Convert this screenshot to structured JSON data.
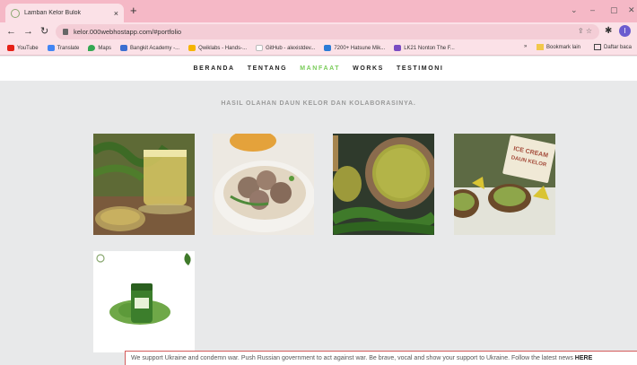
{
  "browser": {
    "tab_title": "Lamban Kelor Bulok",
    "tab_close": "×",
    "new_tab": "+",
    "url": "kelor.000webhostapp.com/#portfolio",
    "window_controls": [
      "⌄",
      "–",
      "▢",
      "✕"
    ],
    "profile_initial": "I",
    "bookmarks": [
      {
        "label": "YouTube",
        "color": "#e62117"
      },
      {
        "label": "Translate",
        "color": "#4285f4"
      },
      {
        "label": "Maps",
        "color": "#34a853"
      },
      {
        "label": "Bangkit Academy -...",
        "color": "#3b6fd1"
      },
      {
        "label": "Qwiklabs - Hands-...",
        "color": "#f5b400"
      },
      {
        "label": "GitHub - alexistdev...",
        "color": "#ffffff"
      },
      {
        "label": "7200+ Hatsune Mik...",
        "color": "#2b7bd6"
      },
      {
        "label": "LK21 Nonton The F...",
        "color": "#7a4cc2"
      }
    ],
    "bookmarks_more": "»",
    "bookmark_folder": "Bookmark lain",
    "reading_list": "Daftar baca"
  },
  "site": {
    "nav": [
      "BERANDA",
      "TENTANG",
      "MANFAAT",
      "WORKS",
      "TESTIMONI"
    ],
    "active_nav": "MANFAAT",
    "section_heading": "HASIL OLAHAN DAUN KELOR DAN KOLABORASINYA.",
    "ukraine_text": "We support Ukraine and condemn war. Push Russian government to act against war. Be brave, vocal and show your support to Ukraine. Follow the latest news ",
    "ukraine_link": "HERE"
  },
  "portfolio": [
    {
      "name": "moringa-tea",
      "caption": ""
    },
    {
      "name": "meatball-soup",
      "caption": ""
    },
    {
      "name": "moringa-powder",
      "caption": ""
    },
    {
      "name": "moringa-ice-cream",
      "caption": "ICE CREAM DAUN KELOR"
    },
    {
      "name": "moringa-capsules",
      "caption": ""
    }
  ]
}
